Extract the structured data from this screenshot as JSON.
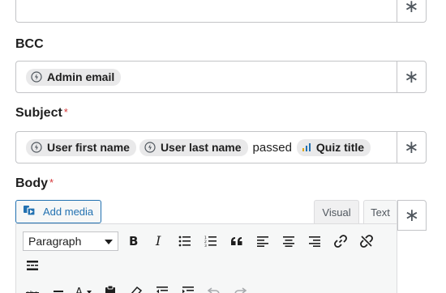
{
  "bcc": {
    "label": "BCC",
    "tags": [
      "Admin email"
    ]
  },
  "subject": {
    "label": "Subject",
    "required_mark": "*",
    "tags": [
      "User first name",
      "User last name"
    ],
    "text": "passed",
    "quiz_tag": "Quiz title"
  },
  "body": {
    "label": "Body",
    "required_mark": "*",
    "add_media_label": "Add media",
    "tabs": [
      "Visual",
      "Text"
    ],
    "format_select": "Paragraph"
  },
  "star_icon": "∗",
  "colors": {
    "accent": "#2271b1",
    "required": "#d63638",
    "tag_bg": "#e9e9ea",
    "quiz_icon_blue": "#2271b1",
    "quiz_icon_orange": "#dba617"
  }
}
